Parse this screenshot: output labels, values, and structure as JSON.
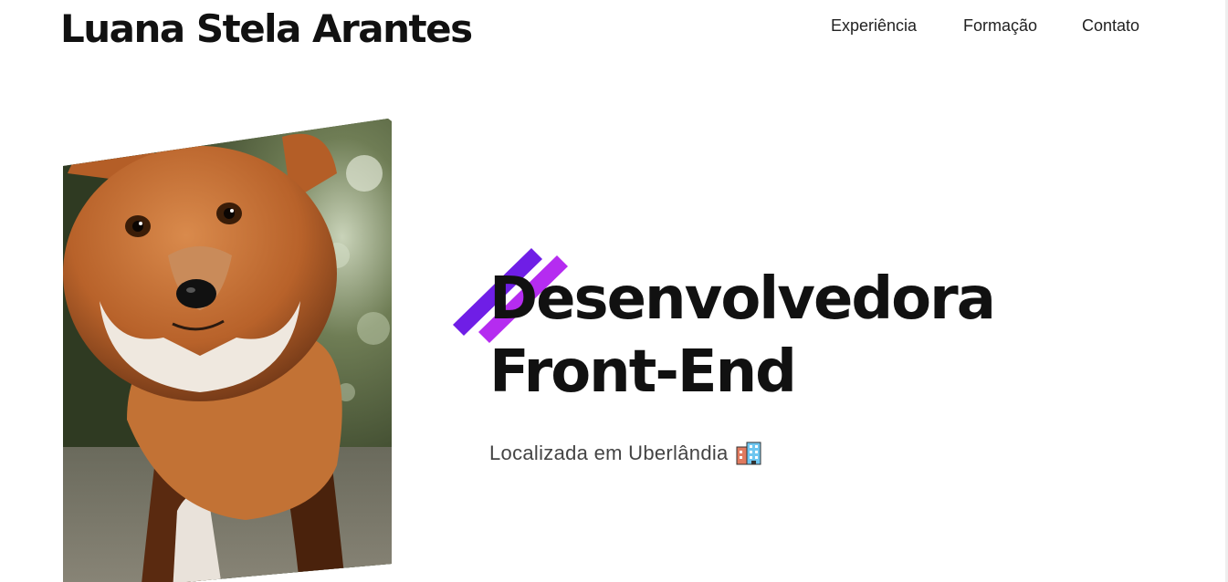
{
  "header": {
    "site_title": "Luana Stela Arantes",
    "nav": [
      {
        "label": "Experiência"
      },
      {
        "label": "Formação"
      },
      {
        "label": "Contato"
      }
    ]
  },
  "hero": {
    "headline_line1": "Desenvolvedora",
    "headline_line2": "Front-End",
    "location": "Localizada em Uberlândia",
    "location_icon": "office-building-icon",
    "photo_subject": "fox-photo",
    "accent_colors": [
      "#6f1ee6",
      "#b52cf0"
    ]
  }
}
